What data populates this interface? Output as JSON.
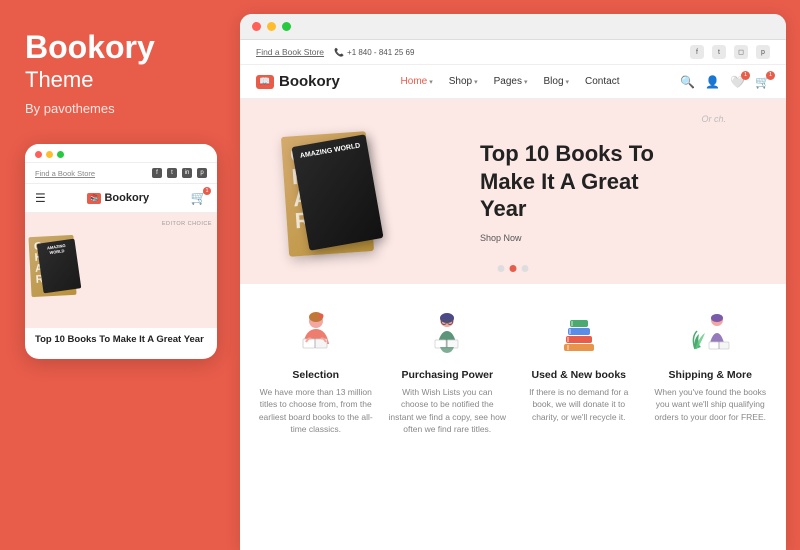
{
  "leftPanel": {
    "title": "Bookory",
    "subtitle": "Theme",
    "byLine": "By pavothemes"
  },
  "browserDots": [
    "red",
    "yellow",
    "green"
  ],
  "website": {
    "topbar": {
      "findStoreLink": "Find a Book Store",
      "phone": "+1 840 - 841 25 69",
      "socialIcons": [
        "f",
        "t",
        "instagram",
        "p"
      ]
    },
    "nav": {
      "logoText": "Bookory",
      "links": [
        {
          "label": "Home",
          "active": true,
          "hasDropdown": true
        },
        {
          "label": "Shop",
          "active": false,
          "hasDropdown": true
        },
        {
          "label": "Pages",
          "active": false,
          "hasDropdown": true
        },
        {
          "label": "Blog",
          "active": false,
          "hasDropdown": true
        },
        {
          "label": "Contact",
          "active": false,
          "hasDropdown": false
        }
      ],
      "actionIcons": [
        "search",
        "user",
        "wishlist",
        "cart"
      ],
      "cartCount": "1",
      "wishlistCount": "1"
    },
    "hero": {
      "tag": "Or ch.",
      "heading": "Top 10 Books To Make It A Great Year",
      "ctaText": "Shop Now",
      "book1Text": "AMAZING WORLD",
      "book2Letters": "CHA RACT ER",
      "dots": [
        false,
        true,
        false
      ]
    },
    "features": [
      {
        "id": "selection",
        "title": "Selection",
        "desc": "We have more than 13 million titles to choose from, from the earliest board books to the all-time classics.",
        "iconColor": "#e06060"
      },
      {
        "id": "purchasing",
        "title": "Purchasing Power",
        "desc": "With Wish Lists you can choose to be notified the instant we find a copy, see how often we find rare titles.",
        "iconColor": "#5b8de8"
      },
      {
        "id": "used-new",
        "title": "Used & New books",
        "desc": "If there is no demand for a book, we will donate it to charity, or we'll recycle it.",
        "iconColor": "#e8944a"
      },
      {
        "id": "shipping",
        "title": "Shipping & More",
        "desc": "When you've found the books you want we'll ship qualifying orders to your door for FREE.",
        "iconColor": "#5ba35b"
      }
    ]
  },
  "mobileMockup": {
    "findLink": "Find a Book Store",
    "logoText": "Bookory",
    "editorTag": "EDITOR CHOICE",
    "heroText": "Top 10 Books To Make It A Great Year",
    "cartBadge": "1"
  }
}
